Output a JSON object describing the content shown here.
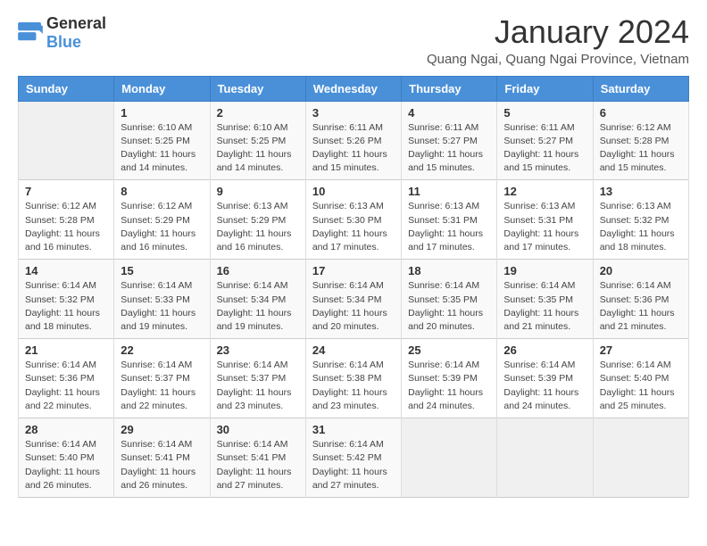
{
  "header": {
    "logo": {
      "general": "General",
      "blue": "Blue"
    },
    "month": "January 2024",
    "location": "Quang Ngai, Quang Ngai Province, Vietnam"
  },
  "days_of_week": [
    "Sunday",
    "Monday",
    "Tuesday",
    "Wednesday",
    "Thursday",
    "Friday",
    "Saturday"
  ],
  "weeks": [
    [
      {
        "day": "",
        "sunrise": "",
        "sunset": "",
        "daylight": ""
      },
      {
        "day": "1",
        "sunrise": "6:10 AM",
        "sunset": "5:25 PM",
        "daylight": "11 hours and 14 minutes."
      },
      {
        "day": "2",
        "sunrise": "6:10 AM",
        "sunset": "5:25 PM",
        "daylight": "11 hours and 14 minutes."
      },
      {
        "day": "3",
        "sunrise": "6:11 AM",
        "sunset": "5:26 PM",
        "daylight": "11 hours and 15 minutes."
      },
      {
        "day": "4",
        "sunrise": "6:11 AM",
        "sunset": "5:27 PM",
        "daylight": "11 hours and 15 minutes."
      },
      {
        "day": "5",
        "sunrise": "6:11 AM",
        "sunset": "5:27 PM",
        "daylight": "11 hours and 15 minutes."
      },
      {
        "day": "6",
        "sunrise": "6:12 AM",
        "sunset": "5:28 PM",
        "daylight": "11 hours and 15 minutes."
      }
    ],
    [
      {
        "day": "7",
        "sunrise": "6:12 AM",
        "sunset": "5:28 PM",
        "daylight": "11 hours and 16 minutes."
      },
      {
        "day": "8",
        "sunrise": "6:12 AM",
        "sunset": "5:29 PM",
        "daylight": "11 hours and 16 minutes."
      },
      {
        "day": "9",
        "sunrise": "6:13 AM",
        "sunset": "5:29 PM",
        "daylight": "11 hours and 16 minutes."
      },
      {
        "day": "10",
        "sunrise": "6:13 AM",
        "sunset": "5:30 PM",
        "daylight": "11 hours and 17 minutes."
      },
      {
        "day": "11",
        "sunrise": "6:13 AM",
        "sunset": "5:31 PM",
        "daylight": "11 hours and 17 minutes."
      },
      {
        "day": "12",
        "sunrise": "6:13 AM",
        "sunset": "5:31 PM",
        "daylight": "11 hours and 17 minutes."
      },
      {
        "day": "13",
        "sunrise": "6:13 AM",
        "sunset": "5:32 PM",
        "daylight": "11 hours and 18 minutes."
      }
    ],
    [
      {
        "day": "14",
        "sunrise": "6:14 AM",
        "sunset": "5:32 PM",
        "daylight": "11 hours and 18 minutes."
      },
      {
        "day": "15",
        "sunrise": "6:14 AM",
        "sunset": "5:33 PM",
        "daylight": "11 hours and 19 minutes."
      },
      {
        "day": "16",
        "sunrise": "6:14 AM",
        "sunset": "5:34 PM",
        "daylight": "11 hours and 19 minutes."
      },
      {
        "day": "17",
        "sunrise": "6:14 AM",
        "sunset": "5:34 PM",
        "daylight": "11 hours and 20 minutes."
      },
      {
        "day": "18",
        "sunrise": "6:14 AM",
        "sunset": "5:35 PM",
        "daylight": "11 hours and 20 minutes."
      },
      {
        "day": "19",
        "sunrise": "6:14 AM",
        "sunset": "5:35 PM",
        "daylight": "11 hours and 21 minutes."
      },
      {
        "day": "20",
        "sunrise": "6:14 AM",
        "sunset": "5:36 PM",
        "daylight": "11 hours and 21 minutes."
      }
    ],
    [
      {
        "day": "21",
        "sunrise": "6:14 AM",
        "sunset": "5:36 PM",
        "daylight": "11 hours and 22 minutes."
      },
      {
        "day": "22",
        "sunrise": "6:14 AM",
        "sunset": "5:37 PM",
        "daylight": "11 hours and 22 minutes."
      },
      {
        "day": "23",
        "sunrise": "6:14 AM",
        "sunset": "5:37 PM",
        "daylight": "11 hours and 23 minutes."
      },
      {
        "day": "24",
        "sunrise": "6:14 AM",
        "sunset": "5:38 PM",
        "daylight": "11 hours and 23 minutes."
      },
      {
        "day": "25",
        "sunrise": "6:14 AM",
        "sunset": "5:39 PM",
        "daylight": "11 hours and 24 minutes."
      },
      {
        "day": "26",
        "sunrise": "6:14 AM",
        "sunset": "5:39 PM",
        "daylight": "11 hours and 24 minutes."
      },
      {
        "day": "27",
        "sunrise": "6:14 AM",
        "sunset": "5:40 PM",
        "daylight": "11 hours and 25 minutes."
      }
    ],
    [
      {
        "day": "28",
        "sunrise": "6:14 AM",
        "sunset": "5:40 PM",
        "daylight": "11 hours and 26 minutes."
      },
      {
        "day": "29",
        "sunrise": "6:14 AM",
        "sunset": "5:41 PM",
        "daylight": "11 hours and 26 minutes."
      },
      {
        "day": "30",
        "sunrise": "6:14 AM",
        "sunset": "5:41 PM",
        "daylight": "11 hours and 27 minutes."
      },
      {
        "day": "31",
        "sunrise": "6:14 AM",
        "sunset": "5:42 PM",
        "daylight": "11 hours and 27 minutes."
      },
      {
        "day": "",
        "sunrise": "",
        "sunset": "",
        "daylight": ""
      },
      {
        "day": "",
        "sunrise": "",
        "sunset": "",
        "daylight": ""
      },
      {
        "day": "",
        "sunrise": "",
        "sunset": "",
        "daylight": ""
      }
    ]
  ],
  "labels": {
    "sunrise": "Sunrise:",
    "sunset": "Sunset:",
    "daylight": "Daylight:"
  }
}
